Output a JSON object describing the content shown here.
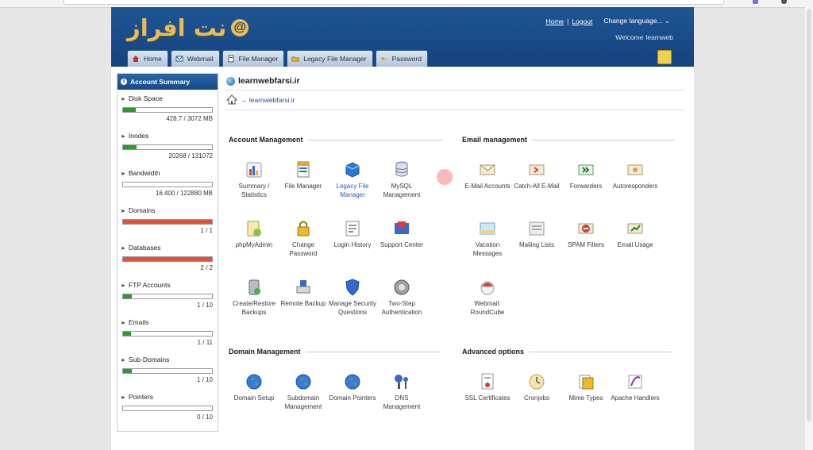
{
  "header": {
    "logo_text": "نت افراز",
    "logo_at": "@",
    "links": {
      "home": "Home",
      "separator": "|",
      "logout": "Logout",
      "language": "Change language... ⌄"
    },
    "welcome_prefix": "Welcome",
    "welcome_user": "learnweb"
  },
  "tabs": [
    {
      "label": "Home",
      "icon": "home-icon"
    },
    {
      "label": "Webmail",
      "icon": "mail-icon"
    },
    {
      "label": "File Manager",
      "icon": "file-icon"
    },
    {
      "label": "Legacy File Manager",
      "icon": "folder-icon"
    },
    {
      "label": "Password",
      "icon": "key-icon"
    }
  ],
  "sidebar": {
    "title": "Account Summary",
    "stats": [
      {
        "label": "Disk Space",
        "value": "428.7 / 3072 MB",
        "fraction": 0.14,
        "color": "#2e9a2e"
      },
      {
        "label": "Inodes",
        "value": "20268 / 131072",
        "fraction": 0.155,
        "color": "#2e9a2e"
      },
      {
        "label": "Bandwidth",
        "value": "16.400 / 122880 MB",
        "fraction": 0.0,
        "color": "#2e9a2e"
      },
      {
        "label": "Domains",
        "value": "1 / 1",
        "fraction": 1.0,
        "color": "#e0533b"
      },
      {
        "label": "Databases",
        "value": "2 / 2",
        "fraction": 1.0,
        "color": "#e0533b"
      },
      {
        "label": "FTP Accounts",
        "value": "1 / 10",
        "fraction": 0.1,
        "color": "#2e9a2e"
      },
      {
        "label": "Emails",
        "value": "1 / 11",
        "fraction": 0.09,
        "color": "#2e9a2e"
      },
      {
        "label": "Sub-Domains",
        "value": "1 / 10",
        "fraction": 0.1,
        "color": "#2e9a2e"
      },
      {
        "label": "Pointers",
        "value": "0 / 10",
        "fraction": 0.0,
        "color": "#2e9a2e"
      }
    ]
  },
  "main": {
    "domain": "learnwebfarsi.ir",
    "breadcrumb": "→ learnwebfarsi.ir",
    "sections": {
      "account": "Account Management",
      "email": "Email management",
      "domain": "Domain Management",
      "advanced": "Advanced options"
    },
    "account_items": [
      "Summary / Statistics",
      "File Manager",
      "Legacy File Manager",
      "MySQL Management",
      "phpMyAdmin",
      "Change Password",
      "Login History",
      "Support Center",
      "Create/Restore Backups",
      "Remote Backup",
      "Manage Security Questions",
      "Two-Step Authentication"
    ],
    "email_items": [
      "E-Mail Accounts",
      "Catch-All E-Mail",
      "Forwarders",
      "Autoresponders",
      "Vacation Messages",
      "Mailing Lists",
      "SPAM Filters",
      "Email Usage",
      "Webmail: RoundCube"
    ],
    "domain_items": [
      "Domain Setup",
      "Subdomain Management",
      "Domain Pointers",
      "DNS Management"
    ],
    "advanced_items": [
      "SSL Certificates",
      "Cronjobs",
      "Mime Types",
      "Apache Handlers"
    ]
  },
  "colors": {
    "header_blue": "#1a4c8a",
    "logo_gold": "#e8bd57",
    "bar_green": "#2e9a2e",
    "bar_red": "#e0533b"
  }
}
